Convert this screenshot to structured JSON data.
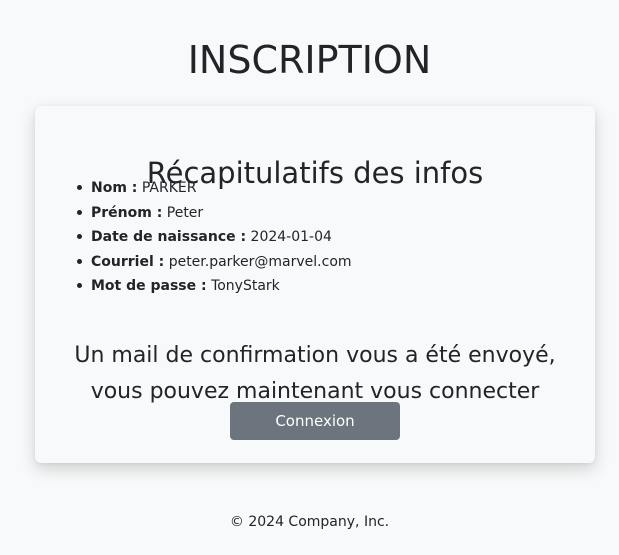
{
  "header": {
    "title": "INSCRIPTION"
  },
  "card": {
    "title": "Récapitulatifs des infos",
    "items": [
      {
        "key": "Nom :",
        "value": "PARKER"
      },
      {
        "key": "Prénom :",
        "value": "Peter"
      },
      {
        "key": "Date de naissance :",
        "value": "2024-01-04"
      },
      {
        "key": "Courriel :",
        "value": "peter.parker@marvel.com"
      },
      {
        "key": "Mot de passe :",
        "value": "TonyStark"
      }
    ],
    "confirmation": {
      "line1": "Un mail de confirmation vous a été envoyé,",
      "line2": "vous pouvez maintenant vous connecter"
    },
    "button_label": "Connexion"
  },
  "footer": {
    "text": "© 2024 Company, Inc."
  },
  "colors": {
    "background": "#f8f9fa",
    "text": "#212529",
    "button": "#6c757d",
    "button_text": "#ffffff"
  }
}
